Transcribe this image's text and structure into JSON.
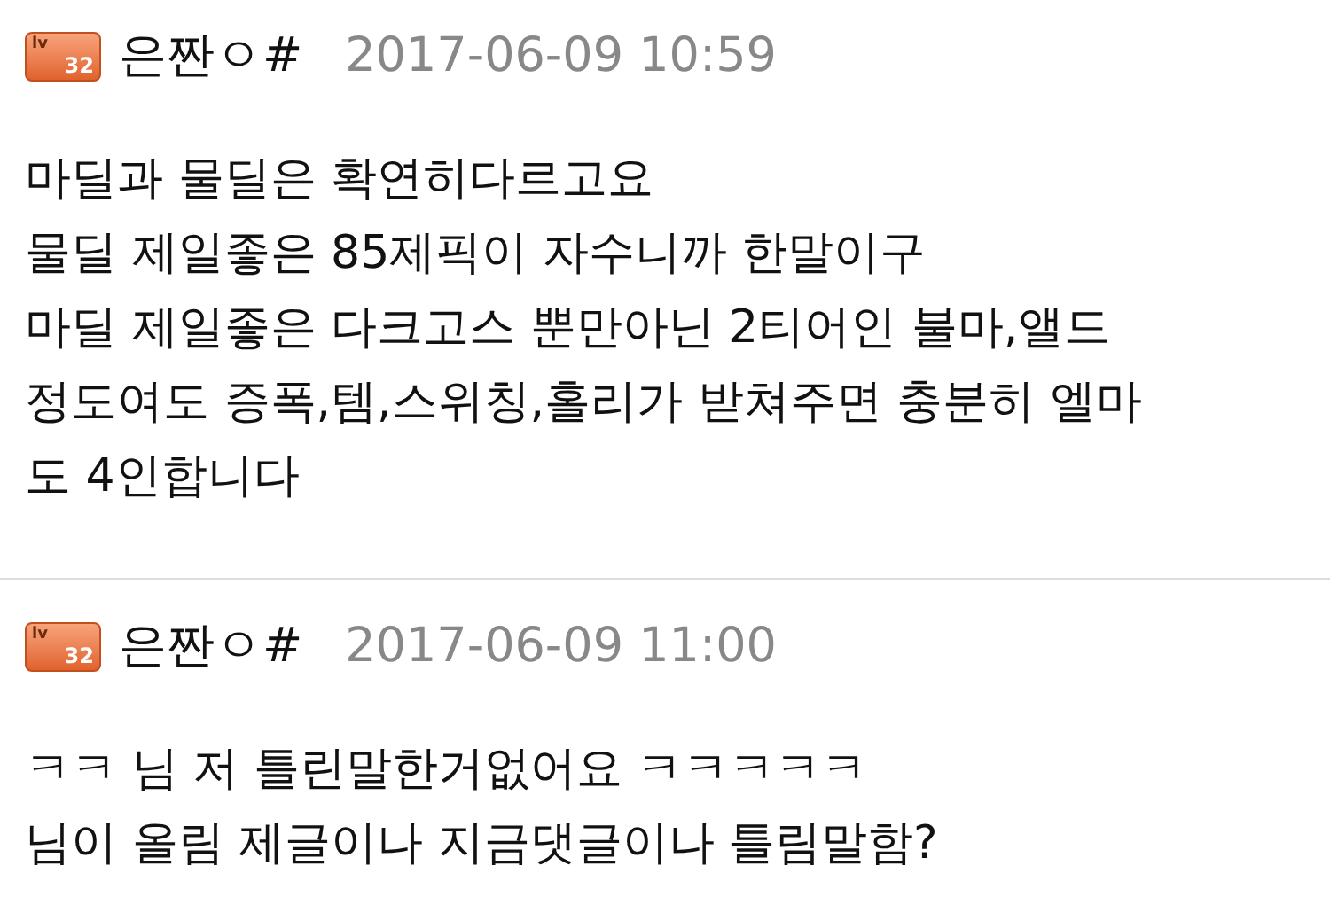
{
  "comments": [
    {
      "badge": {
        "prefix": "lv",
        "number": "32"
      },
      "author": "은짠ㅇ#",
      "date": "2017-06-09 10:59",
      "lines": [
        "마딜과 물딜은 확연히다르고요",
        "물딜 제일좋은 85제픽이 자수니까 한말이구",
        "마딜 제일좋은 다크고스 뿐만아닌 2티어인 불마,앨드",
        "정도여도 증폭,템,스위칭,홀리가 받쳐주면 충분히 엘마",
        "도 4인합니다"
      ]
    },
    {
      "badge": {
        "prefix": "lv",
        "number": "32"
      },
      "author": "은짠ㅇ#",
      "date": "2017-06-09 11:00",
      "lines": [
        "ㅋㅋ 님 저 틀린말한거없어요 ㅋㅋㅋㅋㅋ",
        "님이 올림 제글이나 지금댓글이나 틀림말함?"
      ]
    }
  ]
}
